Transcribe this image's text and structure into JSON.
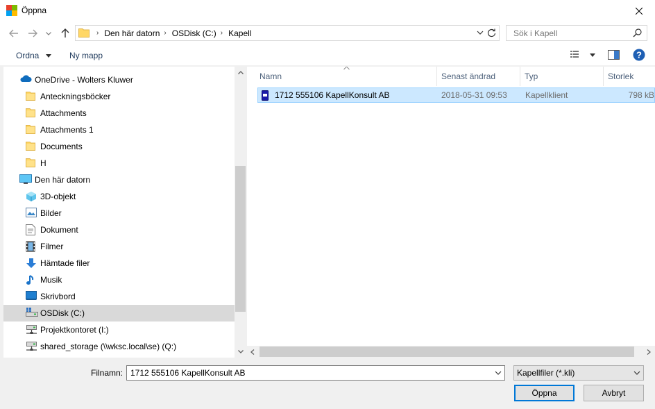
{
  "window": {
    "title": "Öppna"
  },
  "address": {
    "crumbs": [
      "Den här datorn",
      "OSDisk (C:)",
      "Kapell"
    ]
  },
  "search": {
    "placeholder": "Sök i Kapell"
  },
  "toolbar": {
    "organize_label": "Ordna",
    "new_folder_label": "Ny mapp"
  },
  "sidebar": {
    "items": [
      {
        "label": "OneDrive - Wolters Kluwer",
        "icon": "cloud-icon",
        "indent": 0
      },
      {
        "label": "Anteckningsböcker",
        "icon": "folder-icon",
        "indent": 1
      },
      {
        "label": "Attachments",
        "icon": "folder-icon",
        "indent": 1
      },
      {
        "label": "Attachments 1",
        "icon": "folder-icon",
        "indent": 1
      },
      {
        "label": "Documents",
        "icon": "folder-icon",
        "indent": 1
      },
      {
        "label": "H",
        "icon": "folder-icon",
        "indent": 1
      },
      {
        "label": "Den här datorn",
        "icon": "computer-icon",
        "indent": 0
      },
      {
        "label": "3D-objekt",
        "icon": "cube-icon",
        "indent": 1
      },
      {
        "label": "Bilder",
        "icon": "pictures-icon",
        "indent": 1
      },
      {
        "label": "Dokument",
        "icon": "document-icon",
        "indent": 1
      },
      {
        "label": "Filmer",
        "icon": "film-icon",
        "indent": 1
      },
      {
        "label": "Hämtade filer",
        "icon": "download-icon",
        "indent": 1
      },
      {
        "label": "Musik",
        "icon": "music-icon",
        "indent": 1
      },
      {
        "label": "Skrivbord",
        "icon": "desktop-icon",
        "indent": 1
      },
      {
        "label": "OSDisk (C:)",
        "icon": "drive-icon",
        "indent": 1
      },
      {
        "label": "Projektkontoret (I:)",
        "icon": "network-drive-icon",
        "indent": 1
      },
      {
        "label": "shared_storage (\\\\wksc.local\\se) (Q:)",
        "icon": "network-drive-icon",
        "indent": 1
      }
    ],
    "selected": "OSDisk (C:)"
  },
  "columns": [
    "Namn",
    "Senast ändrad",
    "Typ",
    "Storlek"
  ],
  "files": [
    {
      "name": "1712 555106 KapellKonsult AB",
      "modified": "2018-05-31 09:53",
      "type": "Kapellklient",
      "size": "798 kB"
    }
  ],
  "bottom": {
    "filename_label": "Filnamn:",
    "filename_value": "1712 555106 KapellKonsult AB",
    "filetype_value": "Kapellfiler (*.kli)",
    "open_label": "Öppna",
    "cancel_label": "Avbryt"
  },
  "colors": {
    "accent": "#0078d7",
    "selection": "#cce8ff",
    "folder": "#ffd766"
  }
}
